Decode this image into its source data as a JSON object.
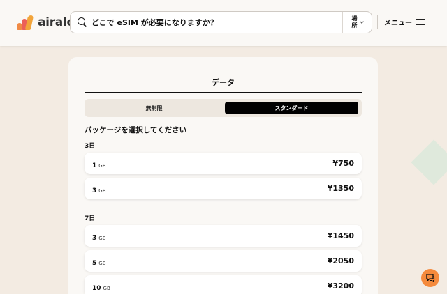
{
  "brand": {
    "logo_text": "airalo"
  },
  "header": {
    "search_placeholder": "どこで eSIM が必要になりますか？",
    "location_label": "場所",
    "menu_label": "メニュー"
  },
  "card": {
    "tab_label": "データ",
    "plan_options": [
      "無制限",
      "スタンダード"
    ],
    "selected_plan": "スタンダード",
    "package_heading": "パッケージを選択してください",
    "groups": [
      {
        "label": "3日",
        "packages": [
          {
            "amount": "1",
            "unit": "GB",
            "price": "¥750"
          },
          {
            "amount": "3",
            "unit": "GB",
            "price": "¥1350"
          }
        ]
      },
      {
        "label": "7日",
        "packages": [
          {
            "amount": "3",
            "unit": "GB",
            "price": "¥1450"
          },
          {
            "amount": "5",
            "unit": "GB",
            "price": "¥2050"
          },
          {
            "amount": "10",
            "unit": "GB",
            "price": "¥3200"
          }
        ]
      }
    ]
  },
  "colors": {
    "background": "#f3ebe2",
    "accent_orange": "#f58a3c",
    "selected_toggle": "#000000"
  },
  "icons": [
    "search-icon",
    "chevron-down-icon",
    "hamburger-icon",
    "chat-icon"
  ]
}
